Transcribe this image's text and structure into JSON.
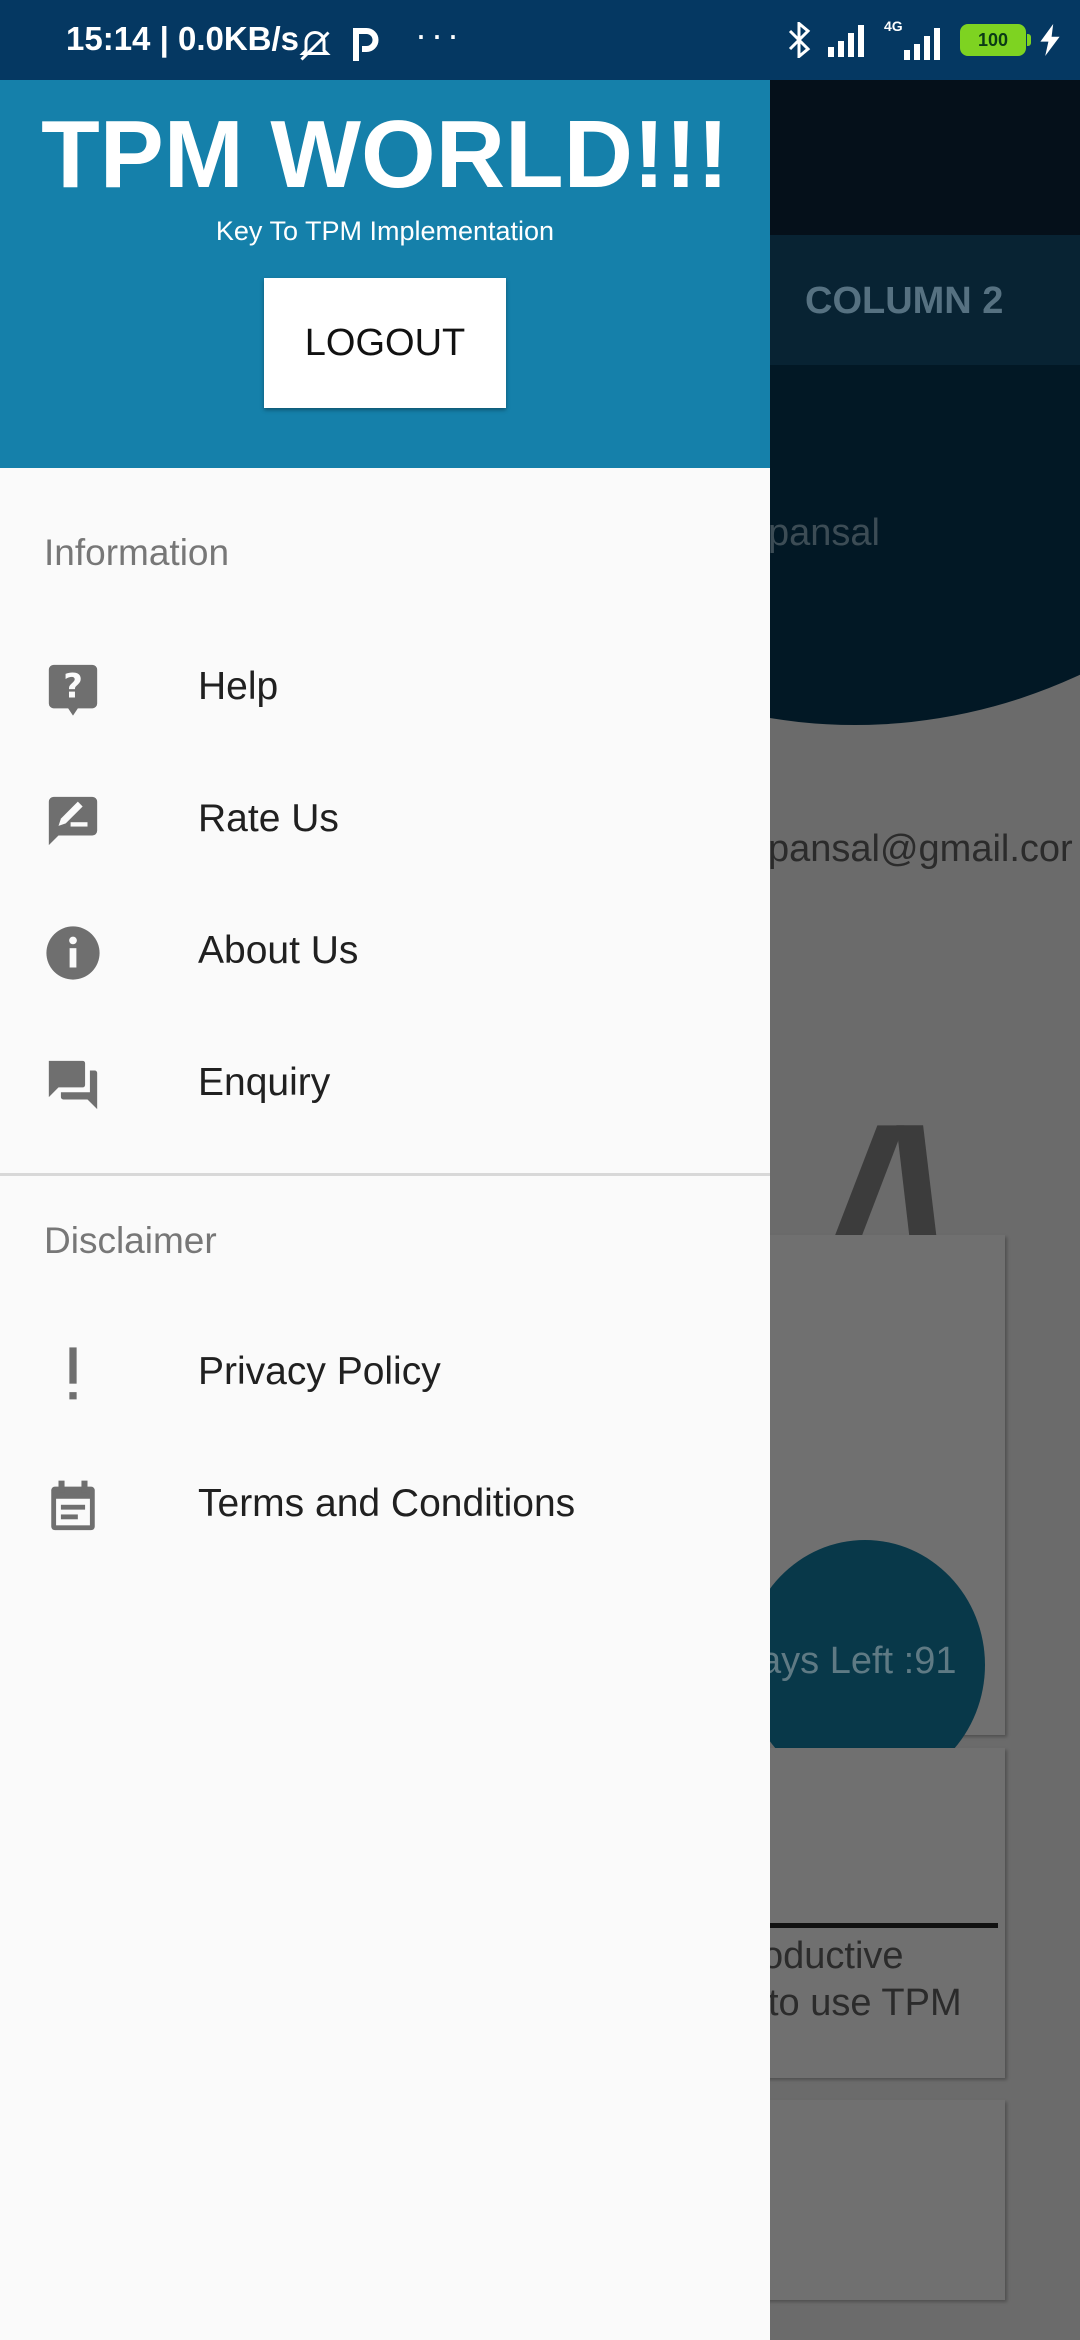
{
  "status_bar": {
    "time_speed": "15:14 | 0.0KB/s",
    "network_label": "4G",
    "battery": "100"
  },
  "background_app": {
    "tab_label": "COLUMN 2",
    "partial_name": "pansal",
    "partial_email": "pansal@gmail.cor",
    "days_left": "ays Left :91",
    "desc_line1": "oductive",
    "desc_line2": " to use TPM"
  },
  "drawer": {
    "title": "TPM WORLD!!!",
    "subtitle": "Key To TPM Implementation",
    "logout_label": "LOGOUT",
    "sections": [
      {
        "title": "Information",
        "items": [
          {
            "label": "Help",
            "icon": "help-icon"
          },
          {
            "label": "Rate Us",
            "icon": "rate-icon"
          },
          {
            "label": "About Us",
            "icon": "info-icon"
          },
          {
            "label": "Enquiry",
            "icon": "forum-icon"
          }
        ]
      },
      {
        "title": "Disclaimer",
        "items": [
          {
            "label": "Privacy Policy",
            "icon": "exclamation-icon"
          },
          {
            "label": "Terms and Conditions",
            "icon": "calendar-icon"
          }
        ]
      }
    ]
  },
  "colors": {
    "header": "#1580aa",
    "status_bar": "#053862",
    "drawer_bg": "#fafafa",
    "icon_gray": "#6f6f6f",
    "scrim": "#6b6b6b"
  }
}
